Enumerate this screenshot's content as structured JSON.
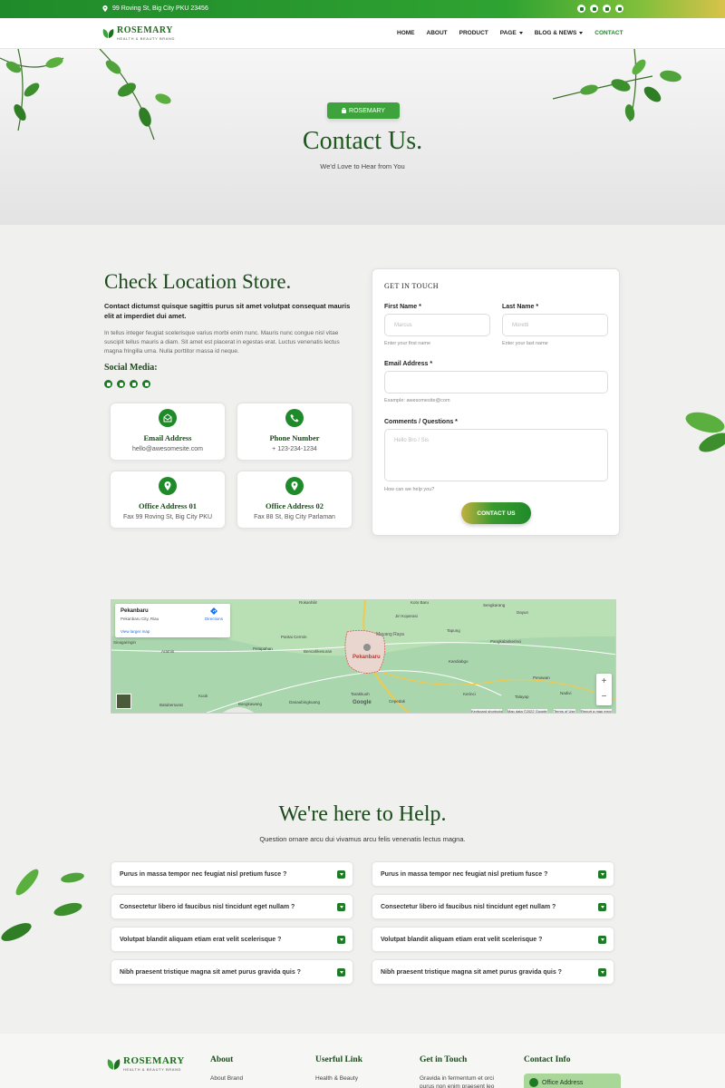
{
  "topbar": {
    "address": "99 Roving St, Big City PKU 23456",
    "social": [
      "facebook-icon",
      "twitter-icon",
      "linkedin-icon",
      "youtube-icon"
    ]
  },
  "brand": {
    "name": "ROSEMARY",
    "tagline": "HEALTH & BEAUTY BRAND"
  },
  "nav": {
    "items": [
      "HOME",
      "ABOUT",
      "PRODUCT",
      "PAGE",
      "BLOG & NEWS",
      "CONTACT"
    ]
  },
  "hero": {
    "badge": "ROSEMARY",
    "title": "Contact Us.",
    "subtitle": "We'd Love to Hear from You"
  },
  "location": {
    "title": "Check Location Store.",
    "lead": "Contact dictumst quisque sagittis purus sit amet volutpat consequat mauris elit at imperdiet dui amet.",
    "body": "In tellus integer feugiat scelerisque varius morbi enim nunc. Mauris nunc congue nisl vitae suscipit tellus mauris a diam. Sit amet est placerat in egestas erat. Luctus venenatis lectus magna fringilla urna. Nulla porttitor massa id neque.",
    "social_title": "Social Media:",
    "cards": [
      {
        "title": "Email Address",
        "value": "hello@awesomesite.com"
      },
      {
        "title": "Phone Number",
        "value": "+ 123-234-1234"
      },
      {
        "title": "Office Address 01",
        "value": "Fax 99 Roving St, Big City PKU"
      },
      {
        "title": "Office Address 02",
        "value": "Fax 88 St, Big City Parlaman"
      }
    ]
  },
  "form": {
    "title": "GET IN TOUCH",
    "first_label": "First Name *",
    "first_placeholder": "Marcus",
    "first_hint": "Enter your first name",
    "last_label": "Last Name *",
    "last_placeholder": "Moretti",
    "last_hint": "Enter your last name",
    "email_label": "Email Address *",
    "email_hint": "Example: awesomesite@com",
    "comments_label": "Comments / Questions *",
    "comments_placeholder": "Hello Bro / Sis",
    "comments_hint": "How can we help you?",
    "submit": "CONTACT US"
  },
  "map": {
    "place": "Pekanbaru",
    "place_sub": "Pekanbaru City, Riau",
    "directions": "Directions",
    "larger": "View larger map",
    "labels": [
      "Rokanhilir",
      "Koto Baru",
      "Sengkarang",
      "Dayun",
      "Jiri Koperasi",
      "Pantai Cermin",
      "Tapung",
      "Mayang Raya",
      "Pangkalankerinci",
      "Kandiabgo",
      "Penawan",
      "Talayap",
      "Nadivi",
      "Kerinci",
      "Pekanbaru",
      "Cepedak",
      "Tarakkuoh",
      "Bangkawang",
      "Danaubingkuang",
      "Kuok",
      "Batubersurat",
      "Aramin",
      "Bencahkesuran",
      "Petapahan",
      "Sinagaringin",
      "Keyboard shortcuts",
      "Map data ©2022 Google",
      "Terms of Use",
      "Report a map error",
      "Google"
    ],
    "zoom_in": "+",
    "zoom_out": "−"
  },
  "help": {
    "title": "We're here to Help.",
    "subtitle": "Question ornare arcu dui vivamus arcu felis venenatis lectus magna.",
    "faqs_left": [
      "Purus in massa tempor nec feugiat nisl pretium fusce ?",
      "Consectetur libero id faucibus nisl tincidunt eget nullam ?",
      "Volutpat blandit aliquam etiam erat velit scelerisque ?",
      "Nibh praesent tristique magna sit amet purus gravida quis ?"
    ],
    "faqs_right": [
      "Purus in massa tempor nec feugiat nisl pretium fusce ?",
      "Consectetur libero id faucibus nisl tincidunt eget nullam ?",
      "Volutpat blandit aliquam etiam erat velit scelerisque ?",
      "Nibh praesent tristique magna sit amet purus gravida quis ?"
    ]
  },
  "footer": {
    "about_title": "About",
    "about_link": "About Brand",
    "useful_title": "Userful Link",
    "useful_link": "Health & Beauty",
    "touch_title": "Get in Touch",
    "touch_text": "Gravida in fermentum et orci purus non enim praesent leo",
    "contact_title": "Contact Info",
    "contact_box": "Office Address"
  },
  "colors": {
    "primary": "#1f8a2a",
    "dark": "#1c4a1c",
    "map": "#a8d8b0"
  }
}
